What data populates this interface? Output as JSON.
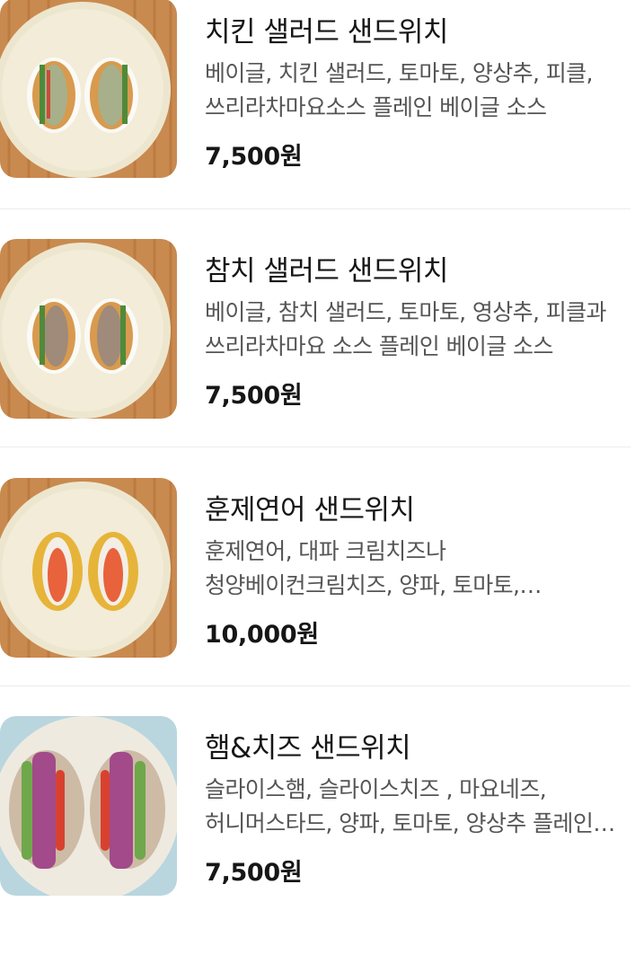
{
  "menu": {
    "items": [
      {
        "name": "치킨 샐러드 샌드위치",
        "description": "베이글, 치킨 샐러드, 토마토, 양상추, 피클, 쓰리라차마요소스 플레인 베이글 소스",
        "price": "7,500원",
        "image": "chicken-salad-sandwich-photo"
      },
      {
        "name": "참치 샐러드 샌드위치",
        "description": "베이글, 참치 샐러드, 토마토, 영상추, 피클과 쓰리라차마요 소스 플레인 베이글 소스",
        "price": "7,500원",
        "image": "tuna-salad-sandwich-photo"
      },
      {
        "name": "훈제연어 샌드위치",
        "description": "훈제연어, 대파 크림치즈나 청양베이컨크림치즈, 양파, 토마토, 쓰리라차마요 소스",
        "price": "10,000원",
        "image": "smoked-salmon-sandwich-photo"
      },
      {
        "name": "햄&치즈 샌드위치",
        "description": "슬라이스햄, 슬라이스치즈 , 마요네즈, 허니머스타드, 양파, 토마토, 양상추 플레인 베이글",
        "price": "7,500원",
        "image": "ham-cheese-sandwich-photo"
      }
    ]
  },
  "colors": {
    "title": "#161616",
    "description": "#555555",
    "price": "#161616",
    "divider": "#ececec"
  }
}
